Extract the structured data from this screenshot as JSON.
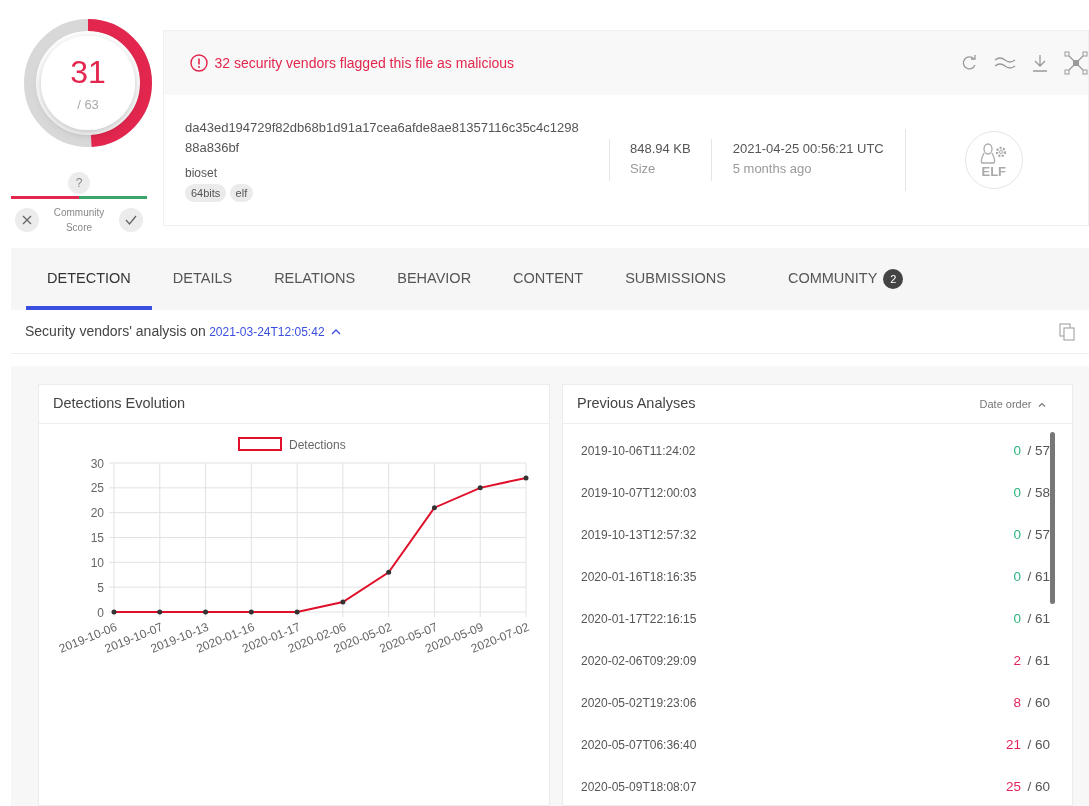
{
  "score": {
    "detections": "31",
    "total": "/ 63",
    "level": 0.49
  },
  "community": {
    "unknown": "?",
    "label": "Community Score"
  },
  "alert": {
    "text": "32 security vendors flagged this file as malicious"
  },
  "file": {
    "hash": "da43ed194729f82db68b1d91a17cea6afde8ae81357116c35c4c129888a836bf",
    "name": "bioset",
    "tags": [
      "64bits",
      "elf"
    ],
    "size": "848.94 KB",
    "size_label": "Size",
    "date": "2021-04-25 00:56:21 UTC",
    "date_ago": "5 months ago",
    "type_label": "ELF"
  },
  "tabs": [
    {
      "label": "DETECTION",
      "selected": true
    },
    {
      "label": "DETAILS",
      "selected": false
    },
    {
      "label": "RELATIONS",
      "selected": false
    },
    {
      "label": "BEHAVIOR",
      "selected": false
    },
    {
      "label": "CONTENT",
      "selected": false
    },
    {
      "label": "SUBMISSIONS",
      "selected": false
    },
    {
      "label": "COMMUNITY",
      "selected": false,
      "count": "2"
    }
  ],
  "analysis": {
    "label": "Security vendors' analysis on",
    "date": "2021-03-24T12:05:42"
  },
  "evolution": {
    "title": "Detections Evolution",
    "chart_data": {
      "type": "line",
      "categories": [
        "2019-10-06",
        "2019-10-07",
        "2019-10-13",
        "2020-01-16",
        "2020-01-17",
        "2020-02-06",
        "2020-05-02",
        "2020-05-07",
        "2020-05-09",
        "2020-07-02"
      ],
      "series": [
        {
          "name": "Detections",
          "color": "#e0102a",
          "values": [
            0,
            0,
            0,
            0,
            0,
            2,
            8,
            21,
            25,
            27
          ]
        }
      ],
      "ylim": [
        0,
        30
      ],
      "grid": true,
      "yticks": [
        0,
        5,
        10,
        15,
        20,
        25,
        30
      ]
    }
  },
  "previous": {
    "title": "Previous Analyses",
    "sort_label": "Date order",
    "items": [
      {
        "date": "2019-10-06T11:24:02",
        "detections": "0",
        "total": "/ 57",
        "color": "#2db47d"
      },
      {
        "date": "2019-10-07T12:00:03",
        "detections": "0",
        "total": "/ 58",
        "color": "#2db47d"
      },
      {
        "date": "2019-10-13T12:57:32",
        "detections": "0",
        "total": "/ 57",
        "color": "#2db47d"
      },
      {
        "date": "2020-01-16T18:16:35",
        "detections": "0",
        "total": "/ 61",
        "color": "#2db47d"
      },
      {
        "date": "2020-01-17T22:16:15",
        "detections": "0",
        "total": "/ 61",
        "color": "#2db47d"
      },
      {
        "date": "2020-02-06T09:29:09",
        "detections": "2",
        "total": "/ 61",
        "color": "#e3245a"
      },
      {
        "date": "2020-05-02T19:23:06",
        "detections": "8",
        "total": "/ 60",
        "color": "#e3245a"
      },
      {
        "date": "2020-05-07T06:36:40",
        "detections": "21",
        "total": "/ 60",
        "color": "#e3245a"
      },
      {
        "date": "2020-05-09T18:08:07",
        "detections": "25",
        "total": "/ 60",
        "color": "#e3245a"
      }
    ]
  }
}
